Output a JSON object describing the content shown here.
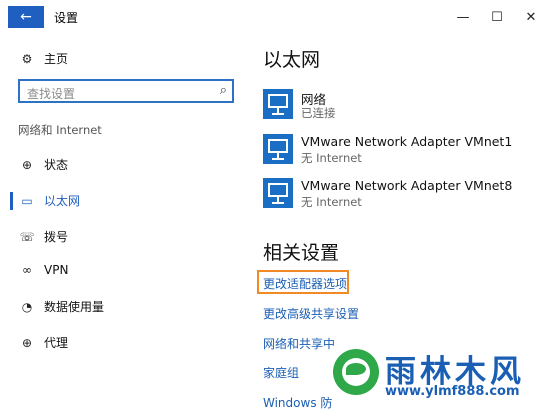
{
  "window": {
    "title": "设置",
    "back_icon": "←",
    "minimize_icon": "—",
    "maximize_icon": "☐",
    "close_icon": "✕"
  },
  "sidebar": {
    "home": {
      "label": "主页",
      "icon": "⚙"
    },
    "search": {
      "placeholder": "查找设置",
      "icon": "⌕"
    },
    "section": "网络和 Internet",
    "items": [
      {
        "label": "状态",
        "icon": "⊕"
      },
      {
        "label": "以太网",
        "icon": "▭"
      },
      {
        "label": "拨号",
        "icon": "☏"
      },
      {
        "label": "VPN",
        "icon": "∞"
      },
      {
        "label": "数据使用量",
        "icon": "◔"
      },
      {
        "label": "代理",
        "icon": "⊕"
      }
    ]
  },
  "main": {
    "heading": "以太网",
    "adapters": [
      {
        "name": "网络",
        "status": "已连接"
      },
      {
        "name": "VMware Network Adapter VMnet1",
        "status": "无 Internet"
      },
      {
        "name": "VMware Network Adapter VMnet8",
        "status": "无 Internet"
      }
    ],
    "related_heading": "相关设置",
    "related_links": [
      "更改适配器选项",
      "更改高级共享设置",
      "网络和共享中",
      "家庭组",
      "Windows 防"
    ]
  },
  "watermark": {
    "text": "雨林木风",
    "url": "www.ylmf888.com"
  },
  "colors": {
    "accent": "#1f5fbf",
    "link": "#1b5fb4",
    "highlight": "#f08a24",
    "watermark_green": "#2fa84a"
  }
}
